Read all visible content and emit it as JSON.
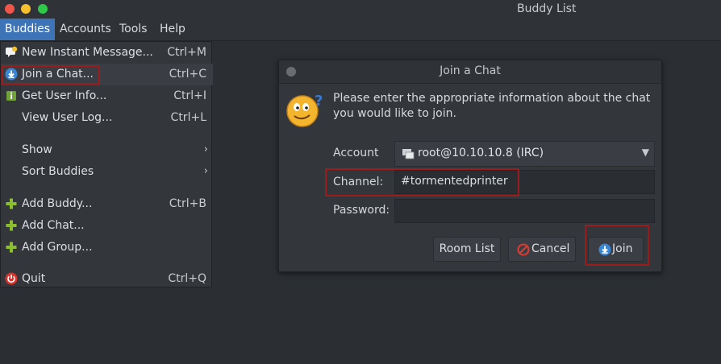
{
  "window": {
    "title": "Buddy List"
  },
  "menubar": {
    "items": [
      "Buddies",
      "Accounts",
      "Tools",
      "Help"
    ]
  },
  "menu": {
    "items": [
      {
        "label": "New Instant Message...",
        "accel": "Ctrl+M"
      },
      {
        "label": "Join a Chat...",
        "accel": "Ctrl+C"
      },
      {
        "label": "Get User Info...",
        "accel": "Ctrl+I"
      },
      {
        "label": "View User Log...",
        "accel": "Ctrl+L"
      },
      {
        "label": "Show",
        "accel": "›"
      },
      {
        "label": "Sort Buddies",
        "accel": "›"
      },
      {
        "label": "Add Buddy...",
        "accel": "Ctrl+B"
      },
      {
        "label": "Add Chat...",
        "accel": ""
      },
      {
        "label": "Add Group...",
        "accel": ""
      },
      {
        "label": "Quit",
        "accel": "Ctrl+Q"
      }
    ]
  },
  "dialog": {
    "title": "Join a Chat",
    "message": "Please enter the appropriate information about the chat you would like to join.",
    "account_label": "Account",
    "account_value": "root@10.10.10.8 (IRC)",
    "channel_label": "Channel:",
    "channel_value": "#tormentedprinter",
    "password_label": "Password:",
    "password_value": "",
    "buttons": {
      "room_list": "Room List",
      "cancel": "Cancel",
      "join": "Join"
    }
  },
  "colors": {
    "accent": "#3d74b8",
    "highlight_border": "#9b1c1c",
    "background": "#2b2e33"
  }
}
